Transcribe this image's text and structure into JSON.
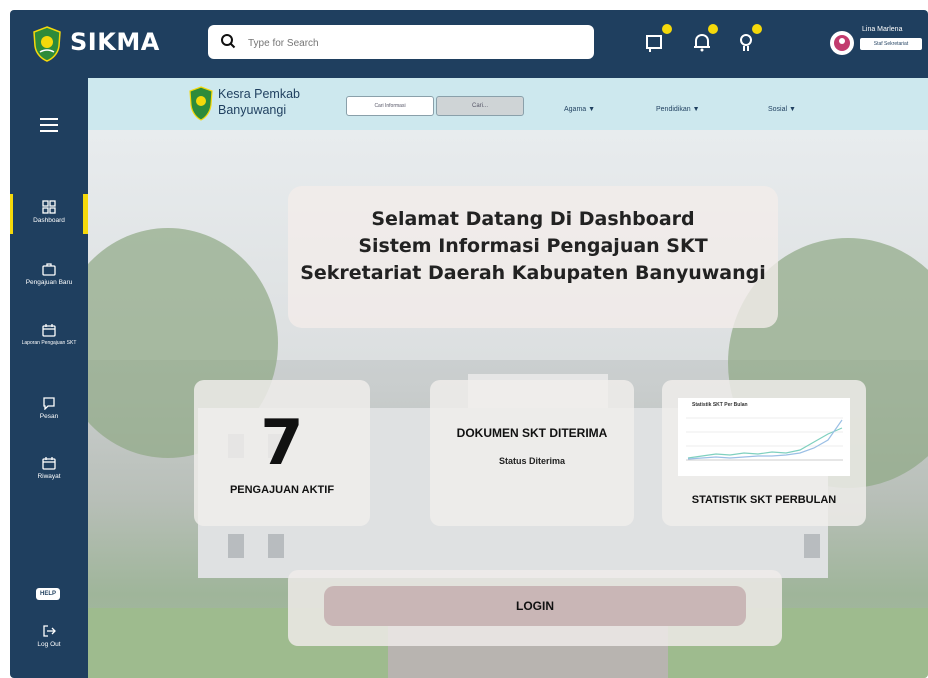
{
  "app": {
    "title": "SIKMA"
  },
  "search": {
    "placeholder": "Type for Search"
  },
  "header": {
    "user_name": "Lina Marlena",
    "user_role": "Staf Sekretariat",
    "icons": [
      "notification-icon",
      "bell-icon",
      "lightbulb-icon"
    ],
    "badge_color": "#f5d90b"
  },
  "subnav": {
    "title": "Kesra Pemkab Banyuwangi",
    "info_button": "Cari Informasi",
    "search_button": "Cari...",
    "menu": [
      "Agama ▼",
      "Pendidikan ▼",
      "Sosial ▼"
    ]
  },
  "sidebar": {
    "items": [
      {
        "label": "Dashboard",
        "icon": "grid-icon",
        "active": true
      },
      {
        "label": "Pengajuan Baru",
        "icon": "briefcase-icon"
      },
      {
        "label": "Laporan Pengajuan SKT",
        "icon": "calendar-icon"
      },
      {
        "label": "Pesan",
        "icon": "chat-icon"
      },
      {
        "label": "Riwayat",
        "icon": "calendar-icon"
      }
    ],
    "help": "HELP",
    "logout": "Log Out"
  },
  "welcome": {
    "line1": "Selamat Datang Di Dashboard",
    "line2": "Sistem Informasi Pengajuan SKT",
    "line3": "Sekretariat Daerah Kabupaten Banyuwangi"
  },
  "cards": {
    "active_count": "7",
    "active_label": "PENGAJUAN AKTIF",
    "doc_title": "DOKUMEN SKT DITERIMA",
    "doc_status": "Status Diterima",
    "chart_title": "Statistik SKT Per Bulan",
    "stats_label": "STATISTIK SKT PERBULAN"
  },
  "login": {
    "label": "LOGIN"
  },
  "colors": {
    "primary": "#1f3f5f",
    "accent": "#f5d90b",
    "subnav_bg": "#cde8ee"
  }
}
